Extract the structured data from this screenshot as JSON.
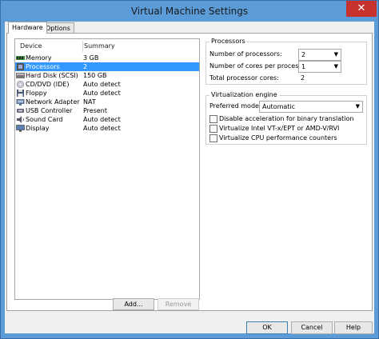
{
  "window": {
    "title": "Virtual Machine Settings",
    "close_glyph": "✕"
  },
  "tabs": [
    {
      "label": "Hardware"
    },
    {
      "label": "Options"
    }
  ],
  "device_list": {
    "headers": {
      "device": "Device",
      "summary": "Summary"
    },
    "rows": [
      {
        "device": "Memory",
        "summary": "3 GB",
        "icon": "memory-icon"
      },
      {
        "device": "Processors",
        "summary": "2",
        "icon": "processor-icon",
        "selected": true
      },
      {
        "device": "Hard Disk (SCSI)",
        "summary": "150 GB",
        "icon": "hard-disk-icon"
      },
      {
        "device": "CD/DVD (IDE)",
        "summary": "Auto detect",
        "icon": "cd-dvd-icon"
      },
      {
        "device": "Floppy",
        "summary": "Auto detect",
        "icon": "floppy-icon"
      },
      {
        "device": "Network Adapter",
        "summary": "NAT",
        "icon": "network-adapter-icon"
      },
      {
        "device": "USB Controller",
        "summary": "Present",
        "icon": "usb-icon"
      },
      {
        "device": "Sound Card",
        "summary": "Auto detect",
        "icon": "sound-card-icon"
      },
      {
        "device": "Display",
        "summary": "Auto detect",
        "icon": "display-icon"
      }
    ],
    "add_label": "Add...",
    "remove_label": "Remove"
  },
  "processors": {
    "group_label": "Processors",
    "num_processors_label": "Number of processors:",
    "num_processors_value": "2",
    "cores_label": "Number of cores per processor:",
    "cores_value": "1",
    "total_label": "Total processor cores:",
    "total_value": "2"
  },
  "virtualization": {
    "group_label": "Virtualization engine",
    "mode_label": "Preferred mode:",
    "mode_value": "Automatic",
    "options": [
      {
        "label": "Disable acceleration for binary translation",
        "checked": false
      },
      {
        "label": "Virtualize Intel VT-x/EPT or AMD-V/RVI",
        "checked": false
      },
      {
        "label": "Virtualize CPU performance counters",
        "checked": false
      }
    ]
  },
  "footer": {
    "ok_label": "OK",
    "cancel_label": "Cancel",
    "help_label": "Help"
  },
  "colors": {
    "titlebar": "#5b9bd8",
    "close": "#c7312e",
    "selection": "#3399ff"
  }
}
